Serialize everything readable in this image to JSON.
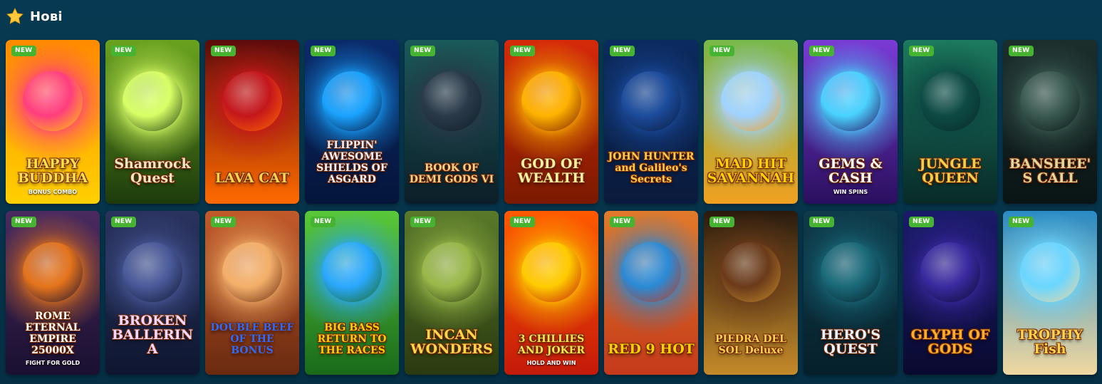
{
  "section": {
    "title": "Нові",
    "icon": "star-icon"
  },
  "badge_label": "NEW",
  "games": [
    {
      "title": "HAPPY BUDDHA",
      "subtitle": "BONUS COMBO",
      "colors": [
        "#ff3d7f",
        "#ff8a00",
        "#ffd000"
      ],
      "title_color": "#ffe04a"
    },
    {
      "title": "Shamrock Quest",
      "subtitle": "",
      "colors": [
        "#d9ff66",
        "#6aa31f",
        "#1d3b0c"
      ],
      "title_color": "#f0e6c8"
    },
    {
      "title": "LAVA CAT",
      "subtitle": "",
      "colors": [
        "#c4161c",
        "#5b0b0b",
        "#ff6a00"
      ],
      "title_color": "#ffd24a"
    },
    {
      "title": "FLIPPIN' AWESOME SHIELDS OF ASGARD",
      "subtitle": "",
      "colors": [
        "#1aa3ff",
        "#0a2a6b",
        "#05153a"
      ],
      "title_color": "#e8f1ff"
    },
    {
      "title": "BOOK OF DEMI GODS VI",
      "subtitle": "",
      "colors": [
        "#2b3a4a",
        "#1a5a5a",
        "#0c1e28"
      ],
      "title_color": "#f3d38a"
    },
    {
      "title": "GOD OF WEALTH",
      "subtitle": "",
      "colors": [
        "#ffb300",
        "#d62a0a",
        "#7a1a00"
      ],
      "title_color": "#fff0a0"
    },
    {
      "title": "JOHN HUNTER and Galileo's Secrets",
      "subtitle": "",
      "colors": [
        "#1c4c9c",
        "#0b2a5e",
        "#0a1a3c"
      ],
      "title_color": "#ffcf4a"
    },
    {
      "title": "MAD HIT SAVANNAH",
      "subtitle": "",
      "colors": [
        "#9fd3ff",
        "#78b84a",
        "#f0a020"
      ],
      "title_color": "#ffd000"
    },
    {
      "title": "GEMS & CASH",
      "subtitle": "WIN SPINS",
      "colors": [
        "#4ad2ff",
        "#7a3bd6",
        "#2a0f5e"
      ],
      "title_color": "#ffffff"
    },
    {
      "title": "JUNGLE QUEEN",
      "subtitle": "",
      "colors": [
        "#0e4a44",
        "#1c7a5e",
        "#082a28"
      ],
      "title_color": "#f3d04a"
    },
    {
      "title": "BANSHEE'S CALL",
      "subtitle": "",
      "colors": [
        "#3a5a52",
        "#1c2e2c",
        "#0a1414"
      ],
      "title_color": "#e2d6a0"
    },
    {
      "title": "ROME ETERNAL EMPIRE 25000X",
      "subtitle": "FIGHT FOR GOLD",
      "colors": [
        "#e5741c",
        "#4a2a60",
        "#1a1030"
      ],
      "title_color": "#ffffff"
    },
    {
      "title": "BROKEN BALLERINA",
      "subtitle": "",
      "colors": [
        "#4a5a9a",
        "#2a335e",
        "#0e1630"
      ],
      "title_color": "#f0d8ff"
    },
    {
      "title": "DOUBLE BEEF OF THE BONUS",
      "subtitle": "",
      "colors": [
        "#f4b06a",
        "#c25a2a",
        "#6a2a10"
      ],
      "title_color": "#2c6bff"
    },
    {
      "title": "BIG BASS RETURN TO THE RACES",
      "subtitle": "",
      "colors": [
        "#2aa8ff",
        "#5ac83a",
        "#1a6a1a"
      ],
      "title_color": "#ffd000"
    },
    {
      "title": "INCAN WONDERS",
      "subtitle": "",
      "colors": [
        "#9ab84a",
        "#5a7a2a",
        "#2a3a10"
      ],
      "title_color": "#ffd84a"
    },
    {
      "title": "3 CHILLIES AND JOKER",
      "subtitle": "HOLD AND WIN",
      "colors": [
        "#ffcc00",
        "#ff5a00",
        "#c41a0a"
      ],
      "title_color": "#ffe84a"
    },
    {
      "title": "RED 9 HOT",
      "subtitle": "",
      "colors": [
        "#2a8ad6",
        "#e07a2a",
        "#c43a1a"
      ],
      "title_color": "#ffd000"
    },
    {
      "title": "PIEDRA DEL SOL Deluxe",
      "subtitle": "",
      "colors": [
        "#6a3a1a",
        "#2a1a0e",
        "#c48a2a"
      ],
      "title_color": "#ffd24a"
    },
    {
      "title": "HERO'S QUEST",
      "subtitle": "",
      "colors": [
        "#1a6a7a",
        "#0e3a4a",
        "#06202a"
      ],
      "title_color": "#e6f4ff"
    },
    {
      "title": "GLYPH OF GODS",
      "subtitle": "",
      "colors": [
        "#3a2aa0",
        "#1a1a6a",
        "#0a0a30"
      ],
      "title_color": "#ffb02a"
    },
    {
      "title": "TROPHY Fish",
      "subtitle": "",
      "colors": [
        "#6ad6ff",
        "#2a8ac4",
        "#f0d8a0"
      ],
      "title_color": "#ffd24a"
    }
  ]
}
